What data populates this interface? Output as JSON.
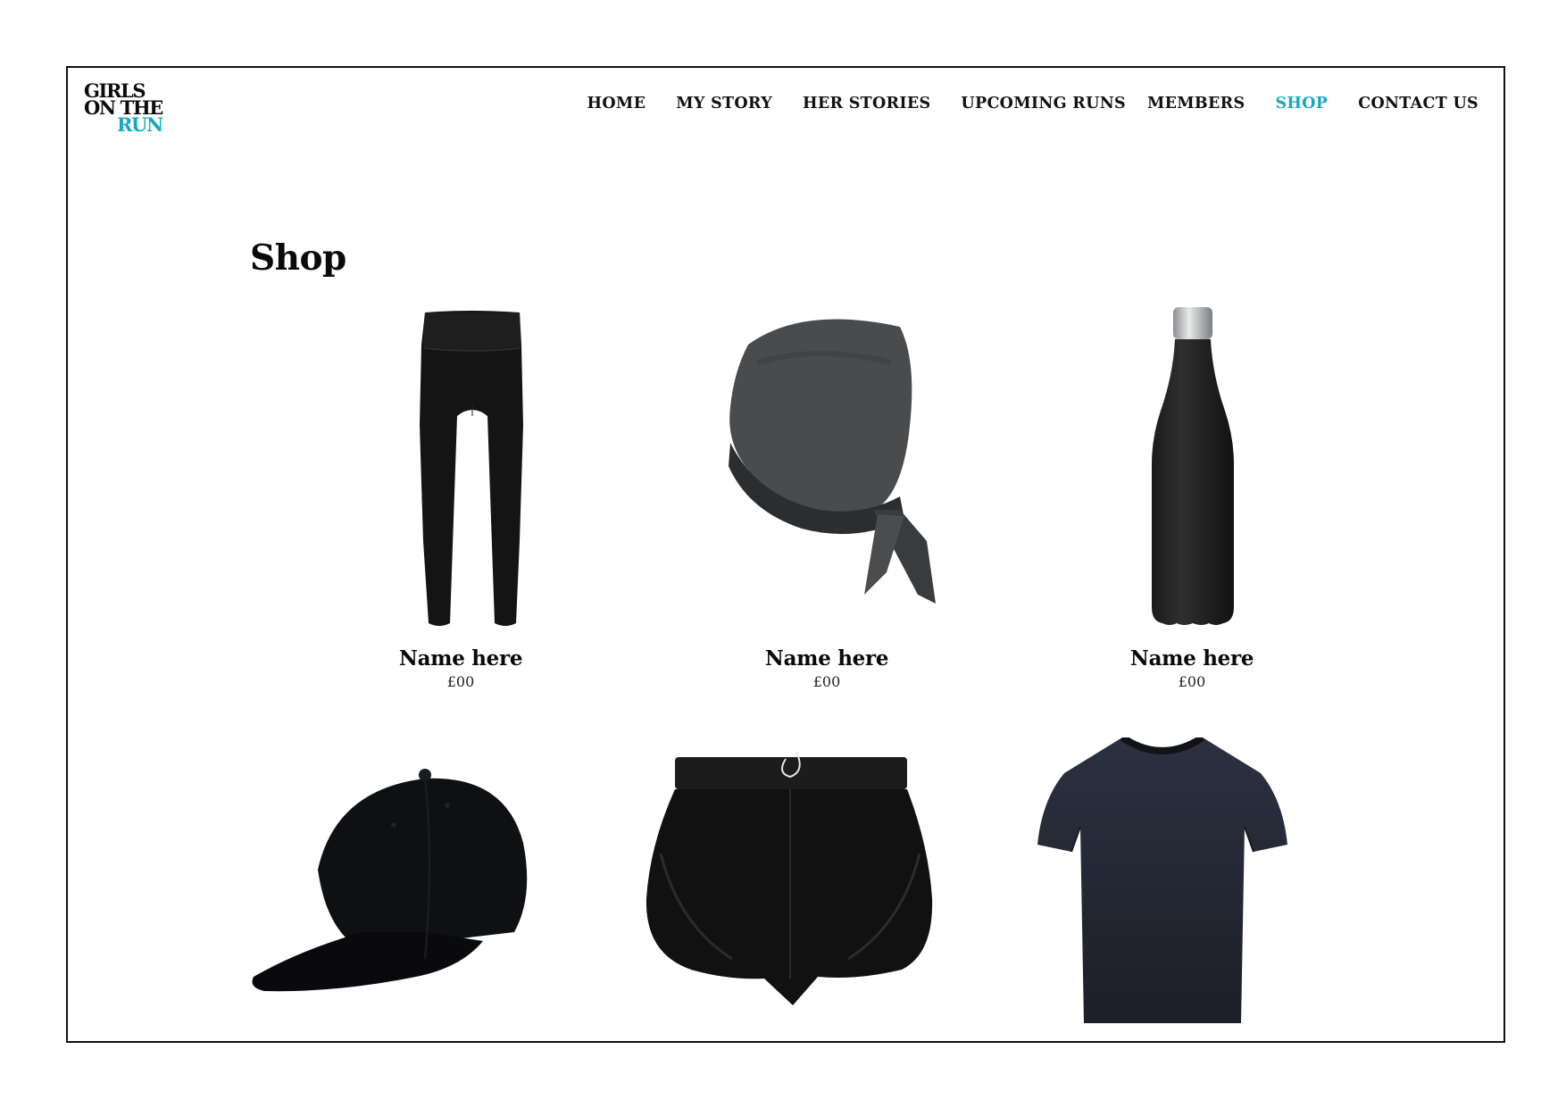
{
  "logo": {
    "line1": "GIRLS",
    "line2": "ON THE",
    "line3": "RUN",
    "accent_color": "#16a9c2"
  },
  "nav": {
    "items": [
      {
        "label": "HOME",
        "active": false
      },
      {
        "label": "MY STORY",
        "active": false
      },
      {
        "label": "HER STORIES",
        "active": false
      },
      {
        "label": "UPCOMING RUNS",
        "active": false
      },
      {
        "label": "MEMBERS",
        "active": false
      },
      {
        "label": "SHOP",
        "active": true
      },
      {
        "label": "CONTACT US",
        "active": false
      }
    ],
    "active_color": "#16a9c2"
  },
  "page": {
    "title": "Shop"
  },
  "products": [
    {
      "icon": "leggings-image",
      "name": "Name here",
      "price": "£00"
    },
    {
      "icon": "bandana-image",
      "name": "Name here",
      "price": "£00"
    },
    {
      "icon": "water-bottle-image",
      "name": "Name here",
      "price": "£00"
    },
    {
      "icon": "cap-image"
    },
    {
      "icon": "shorts-image"
    },
    {
      "icon": "tshirt-image"
    }
  ]
}
